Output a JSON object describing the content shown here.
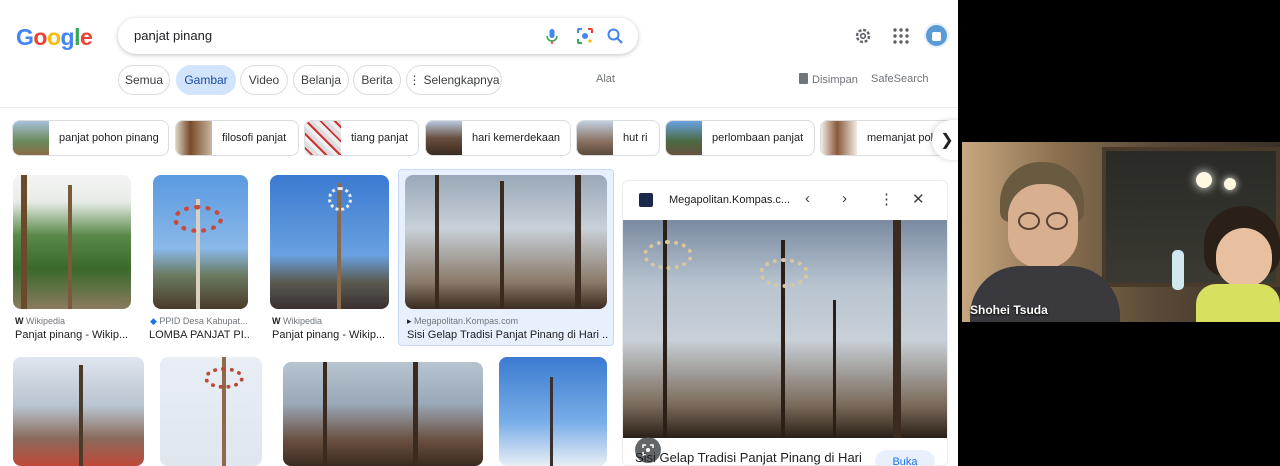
{
  "google": {
    "logo_letters": [
      {
        "ch": "G",
        "color": "#4285f4"
      },
      {
        "ch": "o",
        "color": "#ea4335"
      },
      {
        "ch": "o",
        "color": "#fbbc05"
      },
      {
        "ch": "g",
        "color": "#4285f4"
      },
      {
        "ch": "l",
        "color": "#34a853"
      },
      {
        "ch": "e",
        "color": "#ea4335"
      }
    ],
    "search_query": "panjat pinang",
    "icons": [
      "mic-icon",
      "lens-icon",
      "search-icon",
      "settings-icon",
      "apps-icon",
      "avatar"
    ]
  },
  "tabs": [
    {
      "label": "Semua"
    },
    {
      "label": "Gambar",
      "active": true
    },
    {
      "label": "Video"
    },
    {
      "label": "Belanja"
    },
    {
      "label": "Berita"
    },
    {
      "label": "Selengkapnya",
      "icon": "more-vert-icon"
    }
  ],
  "tools": {
    "alat": "Alat",
    "saved": "Disimpan",
    "safesearch": "SafeSearch"
  },
  "chips": [
    {
      "label": "panjat pohon pinang"
    },
    {
      "label": "filosofi panjat"
    },
    {
      "label": "tiang panjat"
    },
    {
      "label": "hari kemerdekaan"
    },
    {
      "label": "hut ri"
    },
    {
      "label": "perlombaan panjat"
    },
    {
      "label": "memanjat poh"
    }
  ],
  "results": [
    {
      "source": "Wikipedia",
      "title": "Panjat pinang - Wikip..."
    },
    {
      "source": "PPID Desa Kabupat...",
      "title": "LOMBA PANJAT PI..."
    },
    {
      "source": "Wikipedia",
      "title": "Panjat pinang - Wikip..."
    },
    {
      "source": "Megapolitan.Kompas.com",
      "title": "Sisi Gelap Tradisi Panjat Pinang di Hari ..."
    }
  ],
  "preview": {
    "site": "Megapolitan.Kompas.c...",
    "title": "Sisi Gelap Tradisi Panjat Pinang di Hari",
    "visit": "Buka"
  },
  "video_call": {
    "name": "Shohei Tsuda"
  },
  "colors": {
    "accent": "#1a73e8",
    "tab_active_bg": "#d2e3fc"
  }
}
